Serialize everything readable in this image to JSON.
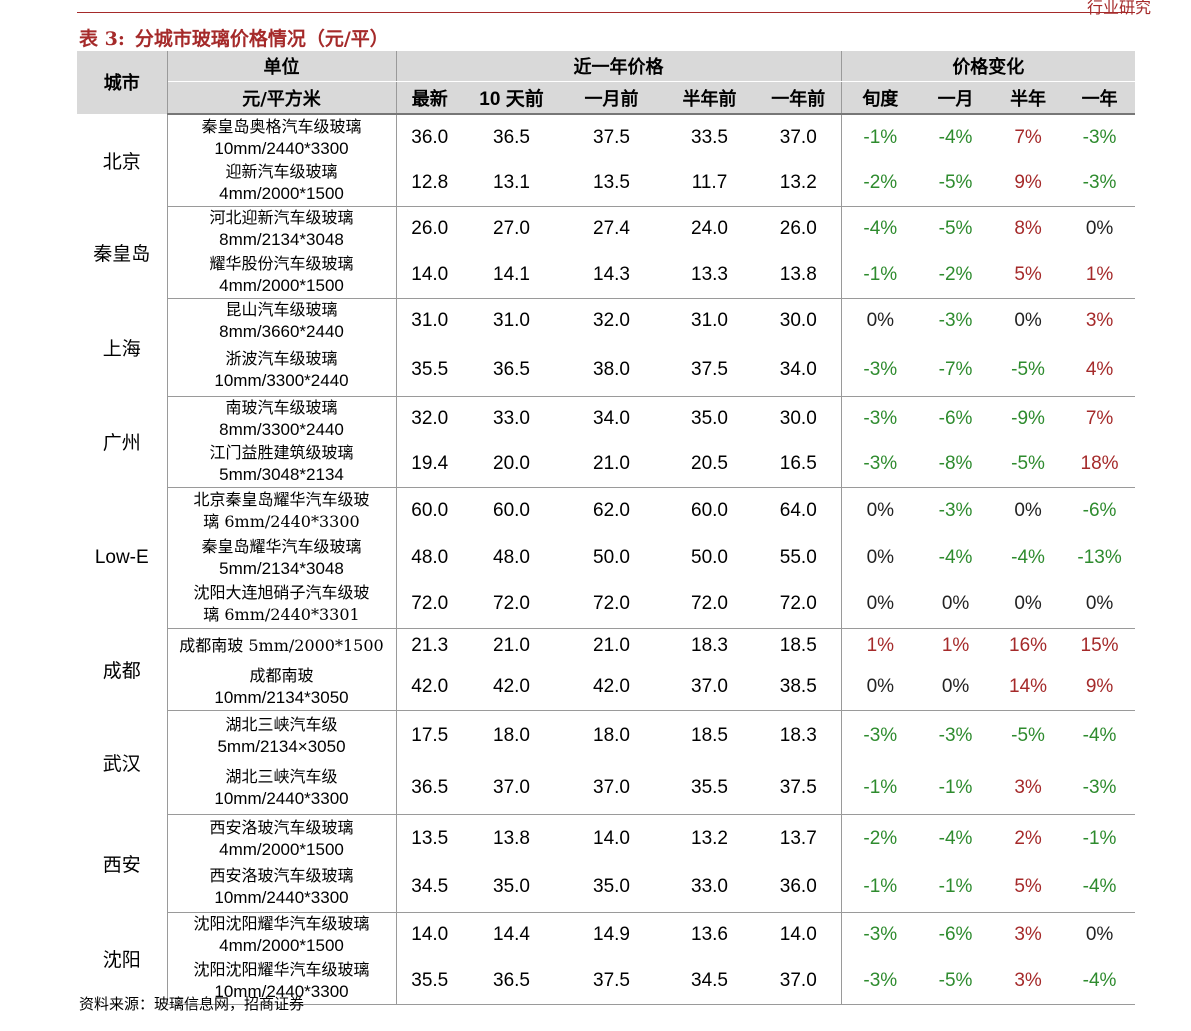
{
  "header_mark": "行业研究",
  "caption": {
    "label": "表 3:",
    "title": "分城市玻璃价格情况（元/平）"
  },
  "columns": {
    "city": "城市",
    "unit": "单位",
    "unit_sub": "元/平方米",
    "price_group": "近一年价格",
    "change_group": "价格变化",
    "price_cols": [
      "最新",
      "10 天前",
      "一月前",
      "半年前",
      "一年前"
    ],
    "change_cols": [
      "旬度",
      "一月",
      "半年",
      "一年"
    ]
  },
  "groups": [
    {
      "city": "北京",
      "rows": [
        {
          "unit": [
            "秦皇岛奥格汽车级玻璃",
            "10mm/2440*3300"
          ],
          "prices": [
            "36.0",
            "36.5",
            "37.5",
            "33.5",
            "37.0"
          ],
          "changes": [
            "-1%",
            "-4%",
            "7%",
            "-3%"
          ]
        },
        {
          "unit": [
            "迎新汽车级玻璃",
            "4mm/2000*1500"
          ],
          "prices": [
            "12.8",
            "13.1",
            "13.5",
            "11.7",
            "13.2"
          ],
          "changes": [
            "-2%",
            "-5%",
            "9%",
            "-3%"
          ]
        }
      ]
    },
    {
      "city": "秦皇岛",
      "rows": [
        {
          "unit": [
            "河北迎新汽车级玻璃",
            "8mm/2134*3048"
          ],
          "prices": [
            "26.0",
            "27.0",
            "27.4",
            "24.0",
            "26.0"
          ],
          "changes": [
            "-4%",
            "-5%",
            "8%",
            "0%"
          ]
        },
        {
          "unit": [
            "耀华股份汽车级玻璃",
            "4mm/2000*1500"
          ],
          "prices": [
            "14.0",
            "14.1",
            "14.3",
            "13.3",
            "13.8"
          ],
          "changes": [
            "-1%",
            "-2%",
            "5%",
            "1%"
          ]
        }
      ]
    },
    {
      "city": "上海",
      "rows": [
        {
          "unit": [
            "昆山汽车级玻璃",
            "8mm/3660*2440"
          ],
          "prices": [
            "31.0",
            "31.0",
            "32.0",
            "31.0",
            "30.0"
          ],
          "changes": [
            "0%",
            "-3%",
            "0%",
            "3%"
          ]
        },
        {
          "unit": [
            "浙波汽车级玻璃",
            "10mm/3300*2440"
          ],
          "prices": [
            "35.5",
            "36.5",
            "38.0",
            "37.5",
            "34.0"
          ],
          "changes": [
            "-3%",
            "-7%",
            "-5%",
            "4%"
          ]
        }
      ]
    },
    {
      "city": "广州",
      "rows": [
        {
          "unit": [
            "南玻汽车级玻璃",
            "8mm/3300*2440"
          ],
          "prices": [
            "32.0",
            "33.0",
            "34.0",
            "35.0",
            "30.0"
          ],
          "changes": [
            "-3%",
            "-6%",
            "-9%",
            "7%"
          ]
        },
        {
          "unit": [
            "江门益胜建筑级玻璃",
            "5mm/3048*2134"
          ],
          "prices": [
            "19.4",
            "20.0",
            "21.0",
            "20.5",
            "16.5"
          ],
          "changes": [
            "-3%",
            "-8%",
            "-5%",
            "18%"
          ]
        }
      ]
    },
    {
      "city": "Low-E",
      "rows": [
        {
          "unit": [
            "北京秦皇岛耀华汽车级玻",
            "璃 6mm/2440*3300"
          ],
          "prices": [
            "60.0",
            "60.0",
            "62.0",
            "60.0",
            "64.0"
          ],
          "changes": [
            "0%",
            "-3%",
            "0%",
            "-6%"
          ]
        },
        {
          "unit": [
            "秦皇岛耀华汽车级玻璃",
            "5mm/2134*3048"
          ],
          "prices": [
            "48.0",
            "48.0",
            "50.0",
            "50.0",
            "55.0"
          ],
          "changes": [
            "0%",
            "-4%",
            "-4%",
            "-13%"
          ]
        },
        {
          "unit": [
            "沈阳大连旭硝子汽车级玻",
            "璃 6mm/2440*3301"
          ],
          "prices": [
            "72.0",
            "72.0",
            "72.0",
            "72.0",
            "72.0"
          ],
          "changes": [
            "0%",
            "0%",
            "0%",
            "0%"
          ]
        }
      ]
    },
    {
      "city": "成都",
      "rows": [
        {
          "unit": [
            "成都南玻 5mm/2000*1500"
          ],
          "prices": [
            "21.3",
            "21.0",
            "21.0",
            "18.3",
            "18.5"
          ],
          "changes": [
            "1%",
            "1%",
            "16%",
            "15%"
          ]
        },
        {
          "unit": [
            "成都南玻",
            "10mm/2134*3050"
          ],
          "prices": [
            "42.0",
            "42.0",
            "42.0",
            "37.0",
            "38.5"
          ],
          "changes": [
            "0%",
            "0%",
            "14%",
            "9%"
          ]
        }
      ]
    },
    {
      "city": "武汉",
      "rows": [
        {
          "unit": [
            "湖北三峡汽车级",
            "5mm/2134×3050"
          ],
          "prices": [
            "17.5",
            "18.0",
            "18.0",
            "18.5",
            "18.3"
          ],
          "changes": [
            "-3%",
            "-3%",
            "-5%",
            "-4%"
          ]
        },
        {
          "unit": [
            "湖北三峡汽车级",
            "10mm/2440*3300"
          ],
          "prices": [
            "36.5",
            "37.0",
            "37.0",
            "35.5",
            "37.5"
          ],
          "changes": [
            "-1%",
            "-1%",
            "3%",
            "-3%"
          ]
        }
      ]
    },
    {
      "city": "西安",
      "rows": [
        {
          "unit": [
            "西安洛玻汽车级玻璃",
            "4mm/2000*1500"
          ],
          "prices": [
            "13.5",
            "13.8",
            "14.0",
            "13.2",
            "13.7"
          ],
          "changes": [
            "-2%",
            "-4%",
            "2%",
            "-1%"
          ]
        },
        {
          "unit": [
            "西安洛玻汽车级玻璃",
            "10mm/2440*3300"
          ],
          "prices": [
            "34.5",
            "35.0",
            "35.0",
            "33.0",
            "36.0"
          ],
          "changes": [
            "-1%",
            "-1%",
            "5%",
            "-4%"
          ]
        }
      ]
    },
    {
      "city": "沈阳",
      "rows": [
        {
          "unit": [
            "沈阳沈阳耀华汽车级玻璃",
            "4mm/2000*1500"
          ],
          "prices": [
            "14.0",
            "14.4",
            "14.9",
            "13.6",
            "14.0"
          ],
          "changes": [
            "-3%",
            "-6%",
            "3%",
            "0%"
          ]
        },
        {
          "unit": [
            "沈阳沈阳耀华汽车级玻璃",
            "10mm/2440*3300"
          ],
          "prices": [
            "35.5",
            "36.5",
            "37.5",
            "34.5",
            "37.0"
          ],
          "changes": [
            "-3%",
            "-5%",
            "3%",
            "-4%"
          ]
        }
      ]
    }
  ],
  "source": "资料来源：玻璃信息网，招商证券",
  "colors": {
    "accent": "#a52a2a",
    "negative": "#2e8b2e",
    "positive": "#a52a2a",
    "header_bg": "#d9d9d9"
  }
}
